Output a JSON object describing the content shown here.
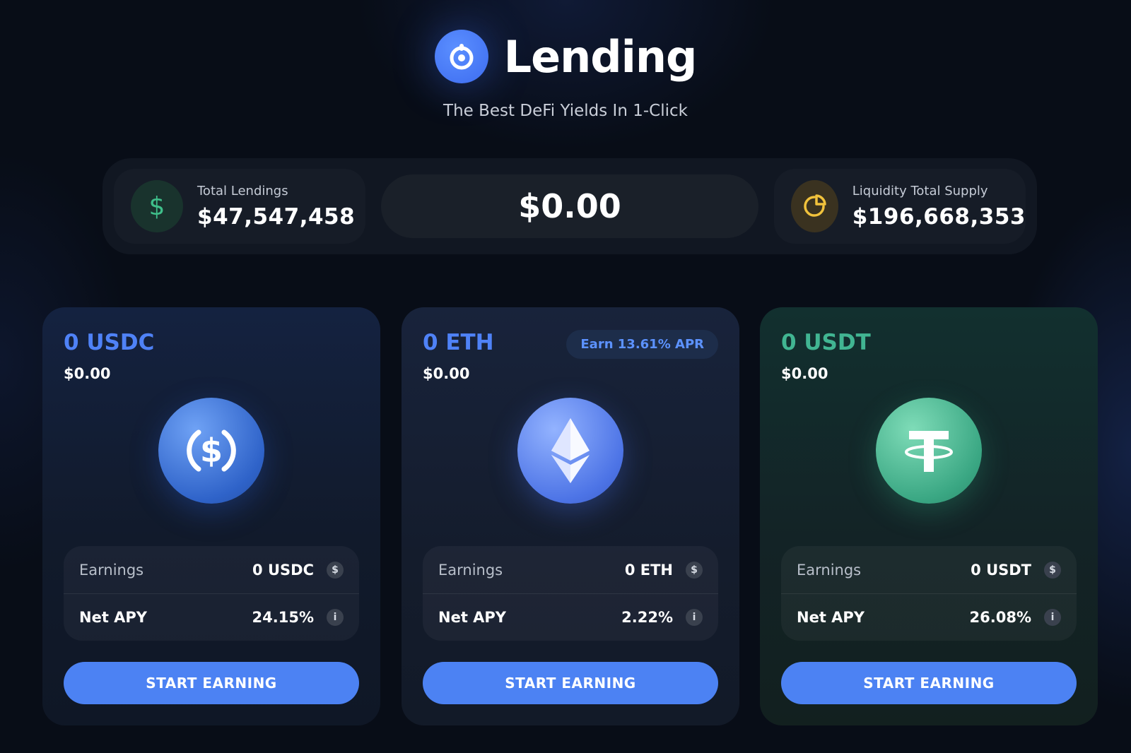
{
  "header": {
    "title": "Lending",
    "subtitle": "The Best DeFi Yields In 1-Click"
  },
  "stats": {
    "total_lendings": {
      "label": "Total Lendings",
      "value": "$47,547,458",
      "icon": "dollar-icon"
    },
    "balance": "$0.00",
    "liquidity_supply": {
      "label": "Liquidity Total Supply",
      "value": "$196,668,353",
      "icon": "pie-chart-icon"
    }
  },
  "cards": [
    {
      "asset": "USDC",
      "amount": "0 USDC",
      "usd_value": "$0.00",
      "earnings_label": "Earnings",
      "earnings_value": "0 USDC",
      "apy_label": "Net APY",
      "apy_value": "24.15%",
      "button": "START EARNING",
      "accent": "#4f82f7"
    },
    {
      "asset": "ETH",
      "amount": "0 ETH",
      "usd_value": "$0.00",
      "badge": "Earn 13.61% APR",
      "earnings_label": "Earnings",
      "earnings_value": "0 ETH",
      "apy_label": "Net APY",
      "apy_value": "2.22%",
      "button": "START EARNING",
      "accent": "#4f82f7"
    },
    {
      "asset": "USDT",
      "amount": "0 USDT",
      "usd_value": "$0.00",
      "earnings_label": "Earnings",
      "earnings_value": "0 USDT",
      "apy_label": "Net APY",
      "apy_value": "26.08%",
      "button": "START EARNING",
      "accent": "#41b592"
    }
  ],
  "colors": {
    "background": "#080d17",
    "primary_button": "#4c82f3",
    "brand_blue": "#3d6cf0"
  }
}
